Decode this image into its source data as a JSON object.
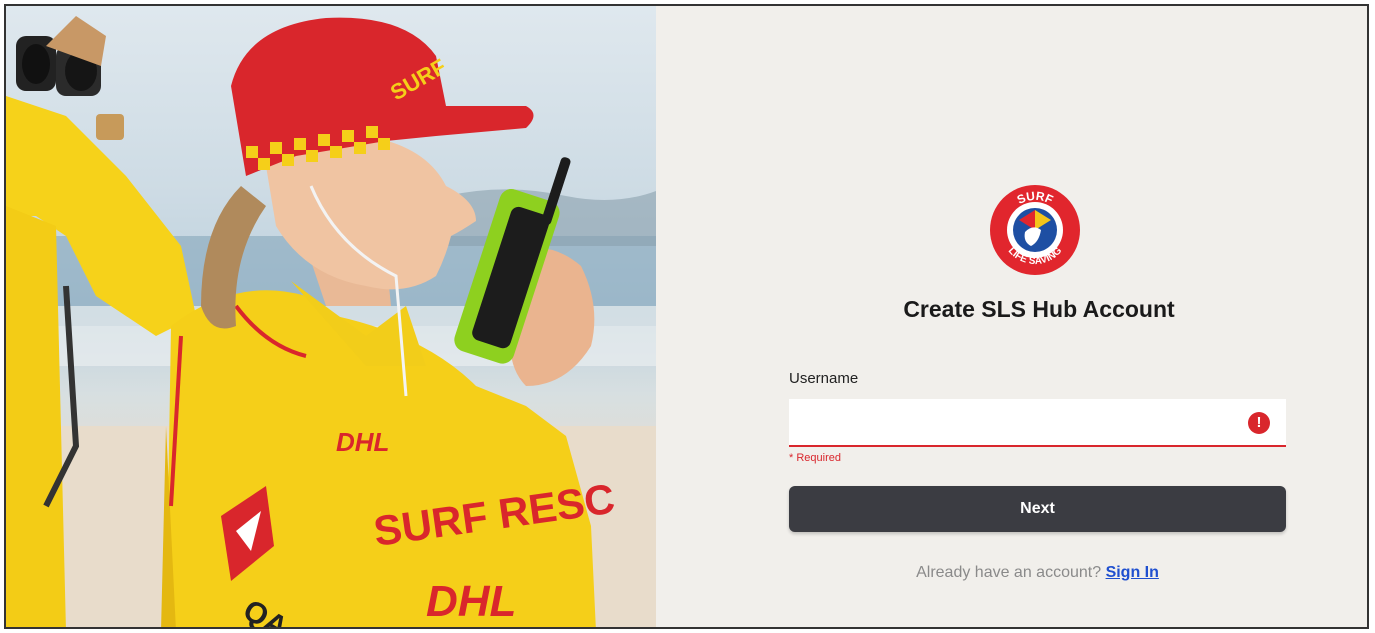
{
  "brand": {
    "logo_text": "SURF LIFE SAVING",
    "logo_colors": {
      "ring": "#e1262d",
      "inner": "#1e4fa3",
      "accent_yellow": "#f4c51a"
    }
  },
  "hero": {
    "description_icon": "lifeguard-photo"
  },
  "form": {
    "title": "Create SLS Hub Account",
    "username_label": "Username",
    "username_value": "",
    "username_placeholder": "",
    "error_icon_glyph": "!",
    "required_text": "* Required",
    "next_label": "Next",
    "signin_prompt": "Already have an account?",
    "signin_link": "Sign In"
  },
  "colors": {
    "error": "#d9262c",
    "button": "#3b3c42",
    "link": "#1f4fcf",
    "panel_bg": "#f1efeb"
  }
}
